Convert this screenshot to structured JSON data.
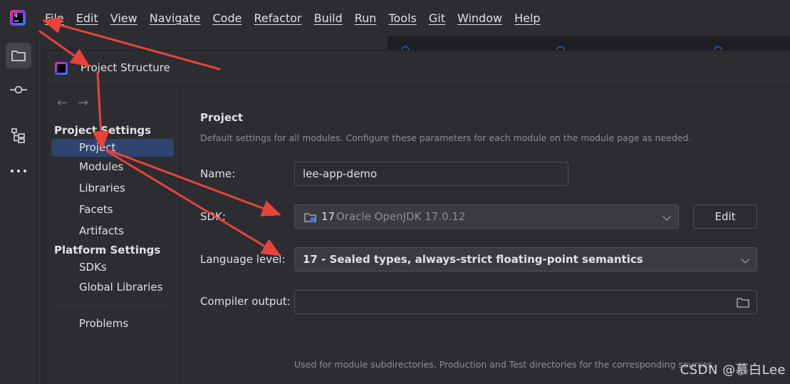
{
  "menubar": {
    "items": [
      "File",
      "Edit",
      "View",
      "Navigate",
      "Code",
      "Refactor",
      "Build",
      "Run",
      "Tools",
      "Git",
      "Window",
      "Help"
    ]
  },
  "dialog": {
    "title": "Project Structure",
    "sidebar": {
      "section_project": "Project Settings",
      "project_items": [
        "Project",
        "Modules",
        "Libraries",
        "Facets",
        "Artifacts"
      ],
      "section_platform": "Platform Settings",
      "platform_items": [
        "SDKs",
        "Global Libraries"
      ],
      "problems": "Problems",
      "selected": "Project"
    },
    "content": {
      "title": "Project",
      "description": "Default settings for all modules. Configure these parameters for each module on the module page as needed.",
      "name_label": "Name:",
      "name_value": "lee-app-demo",
      "sdk_label": "SDK:",
      "sdk_version": "17",
      "sdk_detail": "Oracle OpenJDK 17.0.12",
      "edit_button": "Edit",
      "language_label": "Language level:",
      "language_value": "17 - Sealed types, always-strict floating-point semantics",
      "compiler_label": "Compiler output:",
      "compiler_value": "",
      "compiler_hint": "Used for module subdirectories, Production and Test directories for the corresponding sources."
    }
  },
  "watermark": "CSDN @慕白Lee",
  "colors": {
    "background": "#2b2d30",
    "selection": "#2e436e",
    "annotation_arrow": "#e8433a"
  },
  "icons": [
    "jetbrains-logo-icon",
    "folder-icon",
    "commit-icon",
    "structure-icon",
    "more-icon",
    "back-arrow-icon",
    "forward-arrow-icon",
    "chevron-down-icon",
    "folder-browse-icon"
  ]
}
